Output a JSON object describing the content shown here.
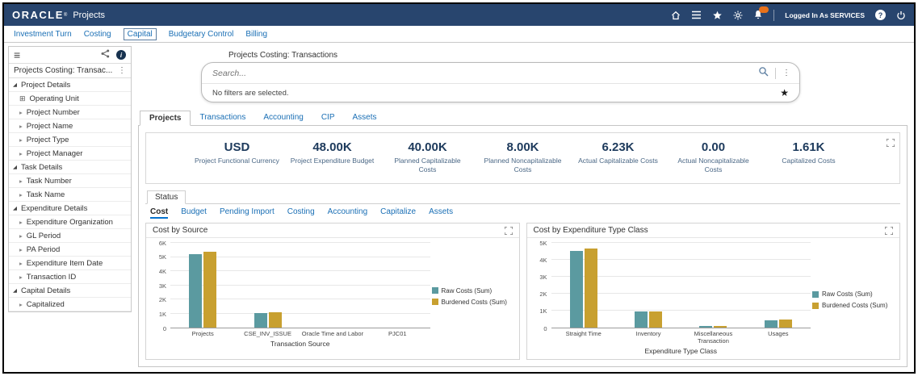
{
  "colors": {
    "topbar_bg": "#28456e",
    "link_blue": "#1a6fb5",
    "kpi_navy": "#1d3a5c",
    "badge_orange": "#e8711a",
    "bar_teal": "#5b9aa0",
    "bar_gold": "#c8a030"
  },
  "header": {
    "brand": "ORACLE",
    "app_title": "Projects",
    "logged_in_text": "Logged In As SERVICES"
  },
  "nav_tabs": {
    "items": [
      {
        "label": "Investment Turn",
        "selected": false
      },
      {
        "label": "Costing",
        "selected": false
      },
      {
        "label": "Capital",
        "selected": true
      },
      {
        "label": "Budgetary Control",
        "selected": false
      },
      {
        "label": "Billing",
        "selected": false
      }
    ]
  },
  "sidebar": {
    "panel_title": "Projects Costing: Transac...",
    "sections": [
      {
        "label": "Project Details",
        "expanded": true,
        "items": [
          {
            "label": "Operating Unit",
            "has_icon": true
          },
          {
            "label": "Project Number"
          },
          {
            "label": "Project Name"
          },
          {
            "label": "Project Type"
          },
          {
            "label": "Project Manager"
          }
        ]
      },
      {
        "label": "Task Details",
        "expanded": true,
        "items": [
          {
            "label": "Task Number"
          },
          {
            "label": "Task Name"
          }
        ]
      },
      {
        "label": "Expenditure Details",
        "expanded": true,
        "items": [
          {
            "label": "Expenditure Organization"
          },
          {
            "label": "GL Period"
          },
          {
            "label": "PA Period"
          },
          {
            "label": "Expenditure Item Date"
          },
          {
            "label": "Transaction ID"
          }
        ]
      },
      {
        "label": "Capital Details",
        "expanded": true,
        "items": [
          {
            "label": "Capitalized"
          }
        ]
      }
    ]
  },
  "main": {
    "context_title": "Projects Costing: Transactions",
    "search": {
      "placeholder": "Search...",
      "filters_text": "No filters are selected."
    },
    "tabs": [
      {
        "label": "Projects",
        "selected": true
      },
      {
        "label": "Transactions",
        "selected": false
      },
      {
        "label": "Accounting",
        "selected": false
      },
      {
        "label": "CIP",
        "selected": false
      },
      {
        "label": "Assets",
        "selected": false
      }
    ],
    "metrics": [
      {
        "value": "USD",
        "label": "Project Functional Currency"
      },
      {
        "value": "48.00K",
        "label": "Project Expenditure Budget"
      },
      {
        "value": "40.00K",
        "label": "Planned Capitalizable Costs"
      },
      {
        "value": "8.00K",
        "label": "Planned Noncapitalizable Costs"
      },
      {
        "value": "6.23K",
        "label": "Actual Capitalizable Costs"
      },
      {
        "value": "0.00",
        "label": "Actual Noncapitalizable Costs"
      },
      {
        "value": "1.61K",
        "label": "Capitalized Costs"
      }
    ],
    "status_tab_label": "Status",
    "sub_tabs": [
      {
        "label": "Cost",
        "selected": true
      },
      {
        "label": "Budget",
        "selected": false
      },
      {
        "label": "Pending Import",
        "selected": false
      },
      {
        "label": "Costing",
        "selected": false
      },
      {
        "label": "Accounting",
        "selected": false
      },
      {
        "label": "Capitalize",
        "selected": false
      },
      {
        "label": "Assets",
        "selected": false
      }
    ]
  },
  "chart_data": [
    {
      "type": "bar",
      "title": "Cost by Source",
      "xlabel": "Transaction Source",
      "ylabel": "",
      "ylim": [
        0,
        6000
      ],
      "yticks": [
        "0",
        "1K",
        "2K",
        "3K",
        "4K",
        "5K",
        "6K"
      ],
      "categories": [
        "Projects",
        "CSE_INV_ISSUE",
        "Oracle Time and Labor",
        "PJC01"
      ],
      "series": [
        {
          "name": "Raw Costs (Sum)",
          "color": "#5b9aa0",
          "values": [
            5200,
            1050,
            0,
            0
          ]
        },
        {
          "name": "Burdened Costs (Sum)",
          "color": "#c8a030",
          "values": [
            5350,
            1080,
            0,
            0
          ]
        }
      ],
      "legend_position": "right",
      "grid": true
    },
    {
      "type": "bar",
      "title": "Cost by Expenditure Type Class",
      "xlabel": "Expenditure Type Class",
      "ylabel": "",
      "ylim": [
        0,
        5000
      ],
      "yticks": [
        "0",
        "1K",
        "2K",
        "3K",
        "4K",
        "5K"
      ],
      "categories": [
        "Straight Time",
        "Inventory",
        "Miscellaneous Transaction",
        "Usages"
      ],
      "series": [
        {
          "name": "Raw Costs (Sum)",
          "color": "#5b9aa0",
          "values": [
            4550,
            950,
            80,
            450
          ]
        },
        {
          "name": "Burdened Costs (Sum)",
          "color": "#c8a030",
          "values": [
            4650,
            980,
            90,
            470
          ]
        }
      ],
      "legend_position": "right",
      "grid": true
    }
  ]
}
